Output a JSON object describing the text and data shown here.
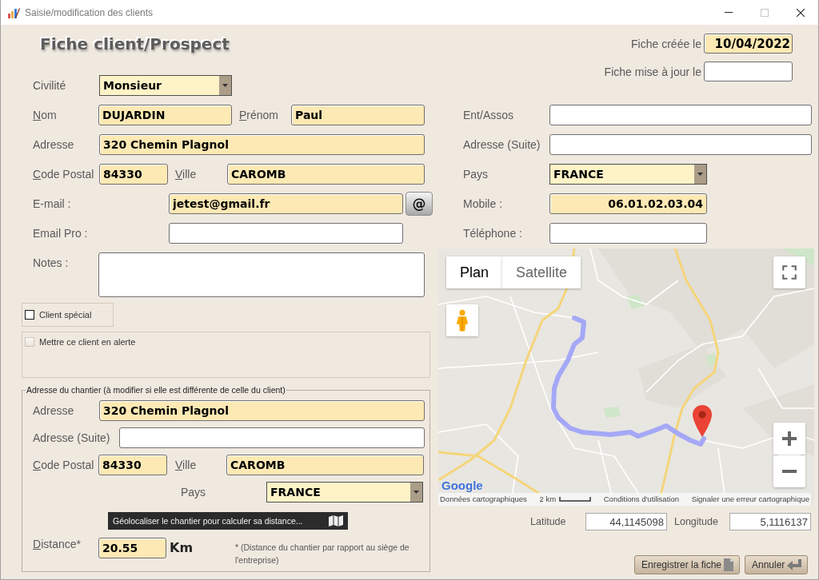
{
  "window": {
    "title": "Saisie/modification des clients",
    "controls": [
      {
        "kind": "minimize",
        "disabled": false
      },
      {
        "kind": "maximize",
        "disabled": true
      },
      {
        "kind": "close",
        "disabled": false
      }
    ]
  },
  "heading": "Fiche client/Prospect",
  "record": {
    "created": {
      "label": "Fiche créée le",
      "value": "10/04/2022"
    },
    "updated": {
      "label": "Fiche mise à jour le"
    }
  },
  "client": {
    "civility": {
      "label": "Civilité",
      "value": "Monsieur"
    },
    "last_name": {
      "label": "Nom",
      "mnemonic": true,
      "value": "DUJARDIN"
    },
    "first_name": {
      "label": "Prénom",
      "mnemonic": true,
      "value": "Paul"
    },
    "address": {
      "label": "Adresse",
      "value": "320 Chemin Plagnol"
    },
    "postal_code": {
      "label": "Code Postal",
      "mnemonic": true,
      "value": "84330"
    },
    "city": {
      "label": "Ville",
      "mnemonic": true,
      "value": "CAROMB"
    },
    "email": {
      "label": "E-mail :",
      "value": "jetest@gmail.fr"
    },
    "email_action": "@",
    "email_pro": {
      "label": "Email Pro :"
    },
    "notes": {
      "label": "Notes :"
    },
    "company": {
      "label": "Ent/Assos"
    },
    "address_2": {
      "label": "Adresse (Suite)"
    },
    "country": {
      "label": "Pays",
      "value": "FRANCE"
    },
    "mobile": {
      "label": "Mobile :",
      "value": "06.01.02.03.04"
    },
    "phone": {
      "label": "Téléphone :"
    }
  },
  "options": [
    {
      "label": "Client spécial",
      "checked": false,
      "disabled": false
    },
    {
      "label": "Mettre ce client en alerte",
      "checked": false,
      "disabled": true
    }
  ],
  "site": {
    "legend": "Adresse du chantier (à modifier si elle est différente de celle du client)",
    "address": {
      "label": "Adresse",
      "value": "320 Chemin Plagnol"
    },
    "address_2": {
      "label": "Adresse (Suite)"
    },
    "postal_code": {
      "label": "Code Postal",
      "mnemonic": true,
      "value": "84330"
    },
    "city": {
      "label": "Ville",
      "mnemonic": true,
      "value": "CAROMB"
    },
    "country": {
      "label": "Pays",
      "value": "FRANCE"
    },
    "geolocate_button": "Géolocaliser le chantier pour calculer sa distance...",
    "distance": {
      "label": "Distance*",
      "mnemonic": true,
      "value": "20.55",
      "unit": "Km"
    },
    "note": "* (Distance du chantier par rapport au siège de l'entreprise)"
  },
  "map": {
    "map_types": [
      {
        "label": "Plan",
        "selected": true
      },
      {
        "label": "Satellite",
        "selected": false
      }
    ],
    "logo": "Google",
    "attribution": "Données cartographiques",
    "scale": "2 km",
    "terms": "Conditions d'utilisation",
    "report": "Signaler une erreur cartographique"
  },
  "coordinates": {
    "latitude": {
      "label": "Latitude",
      "value": "44,1145098"
    },
    "longitude": {
      "label": "Longitude",
      "value": "5,1116137"
    }
  },
  "buttons": [
    {
      "kind": "save",
      "label": "Enregistrer la fiche"
    },
    {
      "kind": "cancel",
      "label": "Annuler"
    }
  ]
}
